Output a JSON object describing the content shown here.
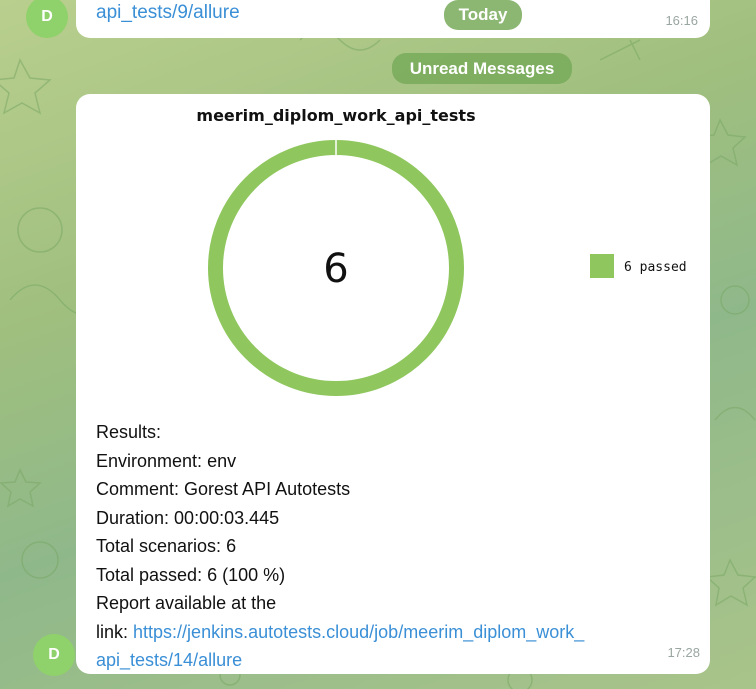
{
  "colors": {
    "avatar": "#8fd16a",
    "link": "#3a8fd6",
    "passed": "#8fc75e",
    "pill": "#78aa5a"
  },
  "top_message": {
    "avatar_letter": "D",
    "link_text": "api_tests/9/allure",
    "time": "16:16"
  },
  "date_pill": "Today",
  "unread_pill": "Unread Messages",
  "report_message": {
    "avatar_letter": "D",
    "time": "17:28",
    "chart_data": {
      "type": "pie",
      "title": "meerim_diplom_work_api_tests",
      "center_label": "6",
      "slices": [
        {
          "name": "6 passed",
          "value": 6,
          "color": "#8fc75e"
        }
      ],
      "legend_position": "right"
    },
    "results_heading": "Results:",
    "fields": [
      {
        "label": "Environment:",
        "value": " env"
      },
      {
        "label": "Comment:",
        "value": " Gorest API Autotests"
      },
      {
        "label": "Duration:",
        "value": " 00:00:03.445"
      },
      {
        "label": "Total scenarios:",
        "value": " 6"
      },
      {
        "label": "Total passed:",
        "value": " 6 (100 %)"
      }
    ],
    "report_line": "Report available at the",
    "link_label": "link:",
    "link_line1": "https://jenkins.autotests.cloud/job/meerim_diplom_work_",
    "link_line2": "api_tests/14/allure"
  }
}
